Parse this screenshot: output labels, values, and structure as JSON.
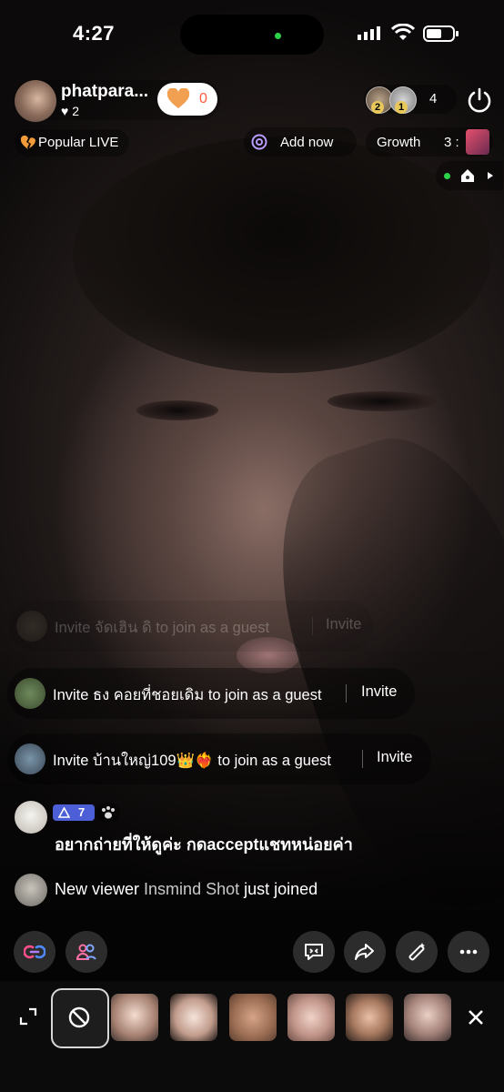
{
  "status_bar": {
    "time": "4:27"
  },
  "host": {
    "name": "phatpara...",
    "likes": "2",
    "like_button_count": "0"
  },
  "viewers": {
    "count": "4",
    "top_ranks": [
      "2",
      "1"
    ]
  },
  "tags": {
    "popular": "Popular LIVE",
    "add_now": "Add now",
    "growth": "Growth",
    "growth_value": "3 :"
  },
  "chat": {
    "invites": [
      {
        "text": "Invite ธง คอยที่ชอยเดิม to join as a guest",
        "action": "Invite"
      },
      {
        "text": "Invite บ้านใหญ่109👑❤️‍🔥 to join as a guest",
        "action": "Invite"
      }
    ],
    "faded_invite": {
      "text": "Invite จัดเฮิน ดิ to join as a guest",
      "action": "Invite"
    },
    "comment": {
      "level": "7",
      "text": "อยากถ่ายที่ให้ดูค่ะ กดacceptแชทหน่อยค่า"
    },
    "join": {
      "prefix": "New viewer",
      "name": "Insmind Shot",
      "suffix": "just joined"
    }
  },
  "colors": {
    "like_accent": "#ff5a3c",
    "level_badge": "#4d5fd6",
    "live_dot": "#2bd34a",
    "link_icon_pink": "#ff4f8a",
    "link_icon_blue": "#4f8aff"
  },
  "icons": {
    "toolbar_left": [
      "link-icon",
      "guests-icon"
    ],
    "toolbar_right": [
      "comment-icon",
      "share-icon",
      "magic-wand-icon",
      "more-icon"
    ],
    "filter_bar": [
      "collapse-icon",
      "no-filter-icon",
      "close-icon"
    ]
  }
}
